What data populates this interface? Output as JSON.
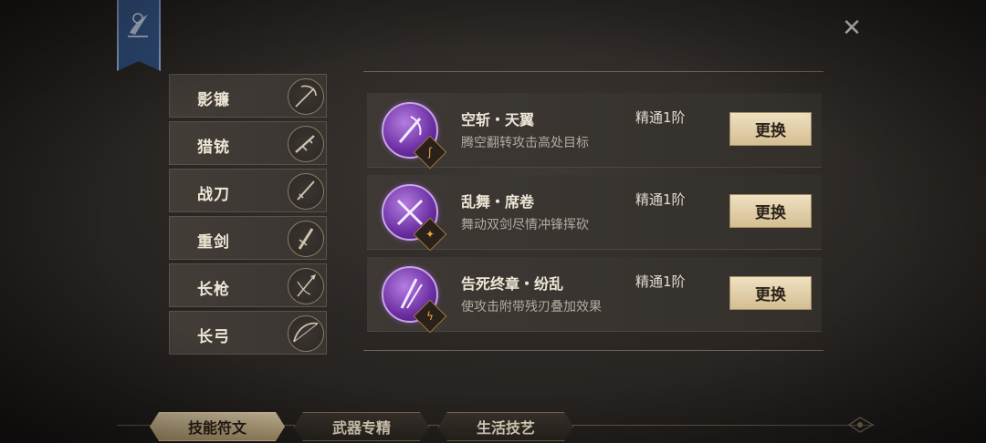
{
  "close_symbol": "✕",
  "weapons": [
    {
      "label": "影镰",
      "icon": "scythe-icon"
    },
    {
      "label": "猎铳",
      "icon": "hunting-gun-icon"
    },
    {
      "label": "战刀",
      "icon": "war-blade-icon"
    },
    {
      "label": "重剑",
      "icon": "greatsword-icon"
    },
    {
      "label": "长枪",
      "icon": "spear-icon"
    },
    {
      "label": "长弓",
      "icon": "longbow-icon"
    }
  ],
  "skills": [
    {
      "name": "空斩・天翼",
      "desc": "腾空翻转攻击高处目标",
      "level": "精通1阶",
      "button": "更换"
    },
    {
      "name": "乱舞・席卷",
      "desc": "舞动双剑尽情冲锋挥砍",
      "level": "精通1阶",
      "button": "更换"
    },
    {
      "name": "告死终章・纷乱",
      "desc": "使攻击附带残刃叠加效果",
      "level": "精通1阶",
      "button": "更换"
    }
  ],
  "tabs": [
    {
      "label": "技能符文",
      "active": true
    },
    {
      "label": "武器专精",
      "active": false
    },
    {
      "label": "生活技艺",
      "active": false
    }
  ],
  "colors": {
    "accent_purple": "#6c2fa3",
    "button_gold": "#d4be93",
    "banner_blue": "#3c5d92"
  }
}
